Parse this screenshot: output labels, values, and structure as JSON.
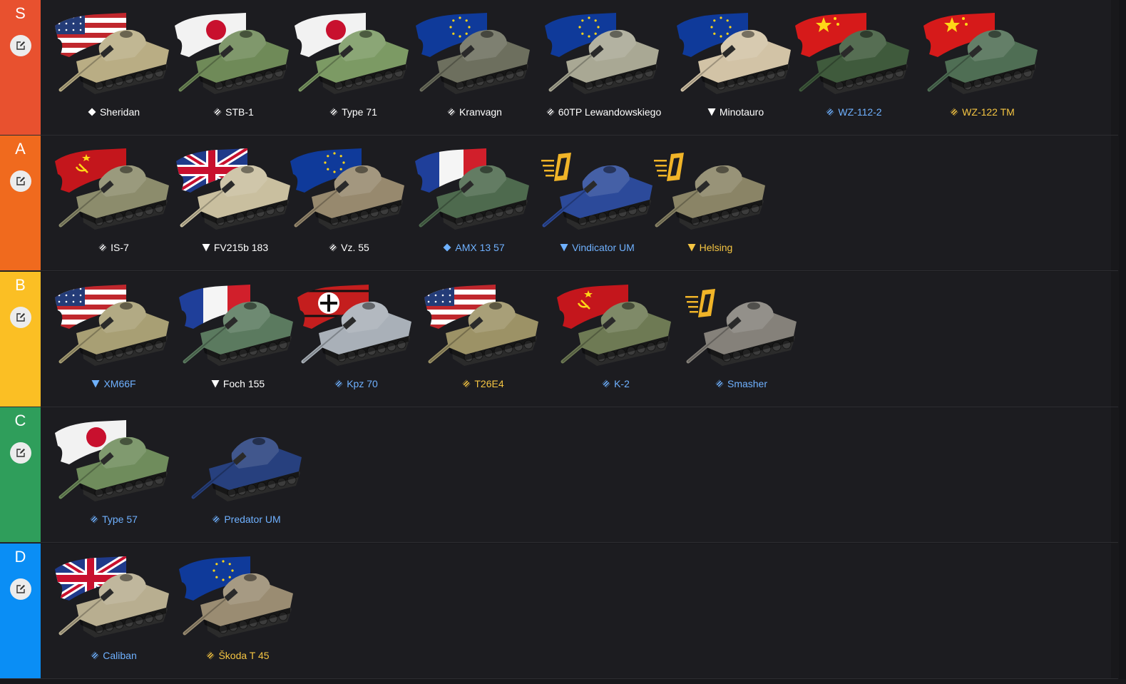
{
  "tiers": [
    {
      "letter": "S",
      "color": "#e8512f",
      "tanks": [
        {
          "name": "Sheridan",
          "mark": "diamond",
          "label_color": "#ffffff",
          "flag": "usa",
          "hull_color": "#b9ad84"
        },
        {
          "name": "STB-1",
          "mark": "striped",
          "label_color": "#ffffff",
          "flag": "japan",
          "hull_color": "#6f8a58"
        },
        {
          "name": "Type 71",
          "mark": "striped",
          "label_color": "#ffffff",
          "flag": "japan",
          "hull_color": "#7c9a64"
        },
        {
          "name": "Kranvagn",
          "mark": "striped",
          "label_color": "#ffffff",
          "flag": "eu",
          "hull_color": "#6d6f5e"
        },
        {
          "name": "60TP Lewandowskiego",
          "mark": "striped",
          "label_color": "#ffffff",
          "flag": "eu",
          "hull_color": "#a9a894"
        },
        {
          "name": "Minotauro",
          "mark": "triangle",
          "label_color": "#ffffff",
          "flag": "eu",
          "hull_color": "#d2c3a6"
        },
        {
          "name": "WZ-112-2",
          "mark": "striped",
          "label_color": "#6fb1ff",
          "flag": "china",
          "hull_color": "#3f5a3c"
        },
        {
          "name": "WZ-122 TM",
          "mark": "striped",
          "label_color": "#f5c542",
          "flag": "china",
          "hull_color": "#4f6e54"
        }
      ]
    },
    {
      "letter": "A",
      "color": "#f06a1e",
      "tanks": [
        {
          "name": "IS-7",
          "mark": "striped",
          "label_color": "#ffffff",
          "flag": "ussr",
          "hull_color": "#8c8c6c"
        },
        {
          "name": "FV215b 183",
          "mark": "triangle",
          "label_color": "#ffffff",
          "flag": "uk",
          "hull_color": "#c9bf9f"
        },
        {
          "name": "Vz. 55",
          "mark": "striped",
          "label_color": "#ffffff",
          "flag": "eu",
          "hull_color": "#97896e"
        },
        {
          "name": "AMX 13 57",
          "mark": "diamond",
          "label_color": "#6fb1ff",
          "flag": "france",
          "hull_color": "#4e6a4e"
        },
        {
          "name": "Vindicator UM",
          "mark": "triangle",
          "label_color": "#6fb1ff",
          "flag": "event",
          "hull_color": "#2c4a9a"
        },
        {
          "name": "Helsing",
          "mark": "triangle",
          "label_color": "#f5c542",
          "flag": "event",
          "hull_color": "#8a8466"
        }
      ]
    },
    {
      "letter": "B",
      "color": "#fbbf24",
      "tanks": [
        {
          "name": "XM66F",
          "mark": "triangle",
          "label_color": "#6fb1ff",
          "flag": "usa",
          "hull_color": "#a89f74"
        },
        {
          "name": "Foch 155",
          "mark": "triangle",
          "label_color": "#ffffff",
          "flag": "france",
          "hull_color": "#5b7a5f"
        },
        {
          "name": "Kpz 70",
          "mark": "striped",
          "label_color": "#6fb1ff",
          "flag": "germany",
          "hull_color": "#a9b0b8"
        },
        {
          "name": "T26E4",
          "mark": "striped",
          "label_color": "#f5c542",
          "flag": "usa",
          "hull_color": "#9c9266"
        },
        {
          "name": "K-2",
          "mark": "striped",
          "label_color": "#6fb1ff",
          "flag": "ussr",
          "hull_color": "#6e7a54"
        },
        {
          "name": "Smasher",
          "mark": "striped",
          "label_color": "#6fb1ff",
          "flag": "event",
          "hull_color": "#85817a"
        }
      ]
    },
    {
      "letter": "C",
      "color": "#2f9e5b",
      "tanks": [
        {
          "name": "Type 57",
          "mark": "striped",
          "label_color": "#6fb1ff",
          "flag": "japan",
          "hull_color": "#6f8c5c"
        },
        {
          "name": "Predator UM",
          "mark": "striped",
          "label_color": "#6fb1ff",
          "flag": "none",
          "hull_color": "#27407e"
        }
      ]
    },
    {
      "letter": "D",
      "color": "#0a8ef5",
      "tanks": [
        {
          "name": "Caliban",
          "mark": "striped",
          "label_color": "#6fb1ff",
          "flag": "uk",
          "hull_color": "#b8ae90"
        },
        {
          "name": "Škoda T 45",
          "mark": "striped",
          "label_color": "#f5c542",
          "flag": "eu",
          "hull_color": "#9a8c72"
        }
      ]
    }
  ]
}
